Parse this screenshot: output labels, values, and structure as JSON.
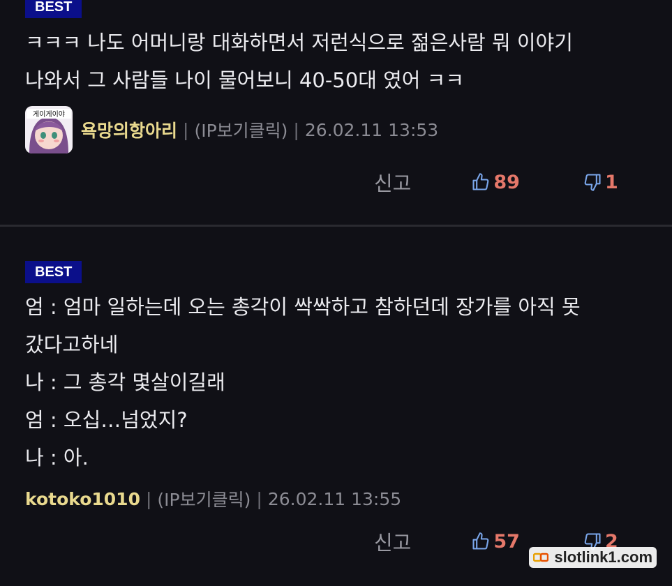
{
  "comments": [
    {
      "badge": "BEST",
      "lines": [
        "ㅋㅋㅋ 나도 어머니랑 대화하면서 저런식으로 젊은사람 뭐 이야기",
        "나와서 그 사람들 나이 물어보니 40-50대 였어 ㅋㅋ"
      ],
      "author": "욕망의항아리",
      "ip": "(IP보기클릭)",
      "date": "26.02.11 13:53",
      "report": "신고",
      "likes": "89",
      "dislikes": "1",
      "avatar_text": "게이게이야"
    },
    {
      "badge": "BEST",
      "lines": [
        "엄 : 엄마 일하는데 오는 총각이 싹싹하고 참하던데 장가를 아직 못",
        "갔다고하네",
        "나 : 그 총각 몇살이길래",
        "엄 : 오십…넘었지?",
        "나 : 아."
      ],
      "author": "kotoko1010",
      "ip": "(IP보기클릭)",
      "date": "26.02.11 13:55",
      "report": "신고",
      "likes": "57",
      "dislikes": "2"
    }
  ],
  "watermark": "slotlink1.com",
  "colors": {
    "badge": "#0b0f8a",
    "nickname": "#e9d98e",
    "vote": "#e5786a",
    "background": "#101016"
  },
  "icons": [
    "thumbs-up-icon",
    "thumbs-down-icon"
  ]
}
